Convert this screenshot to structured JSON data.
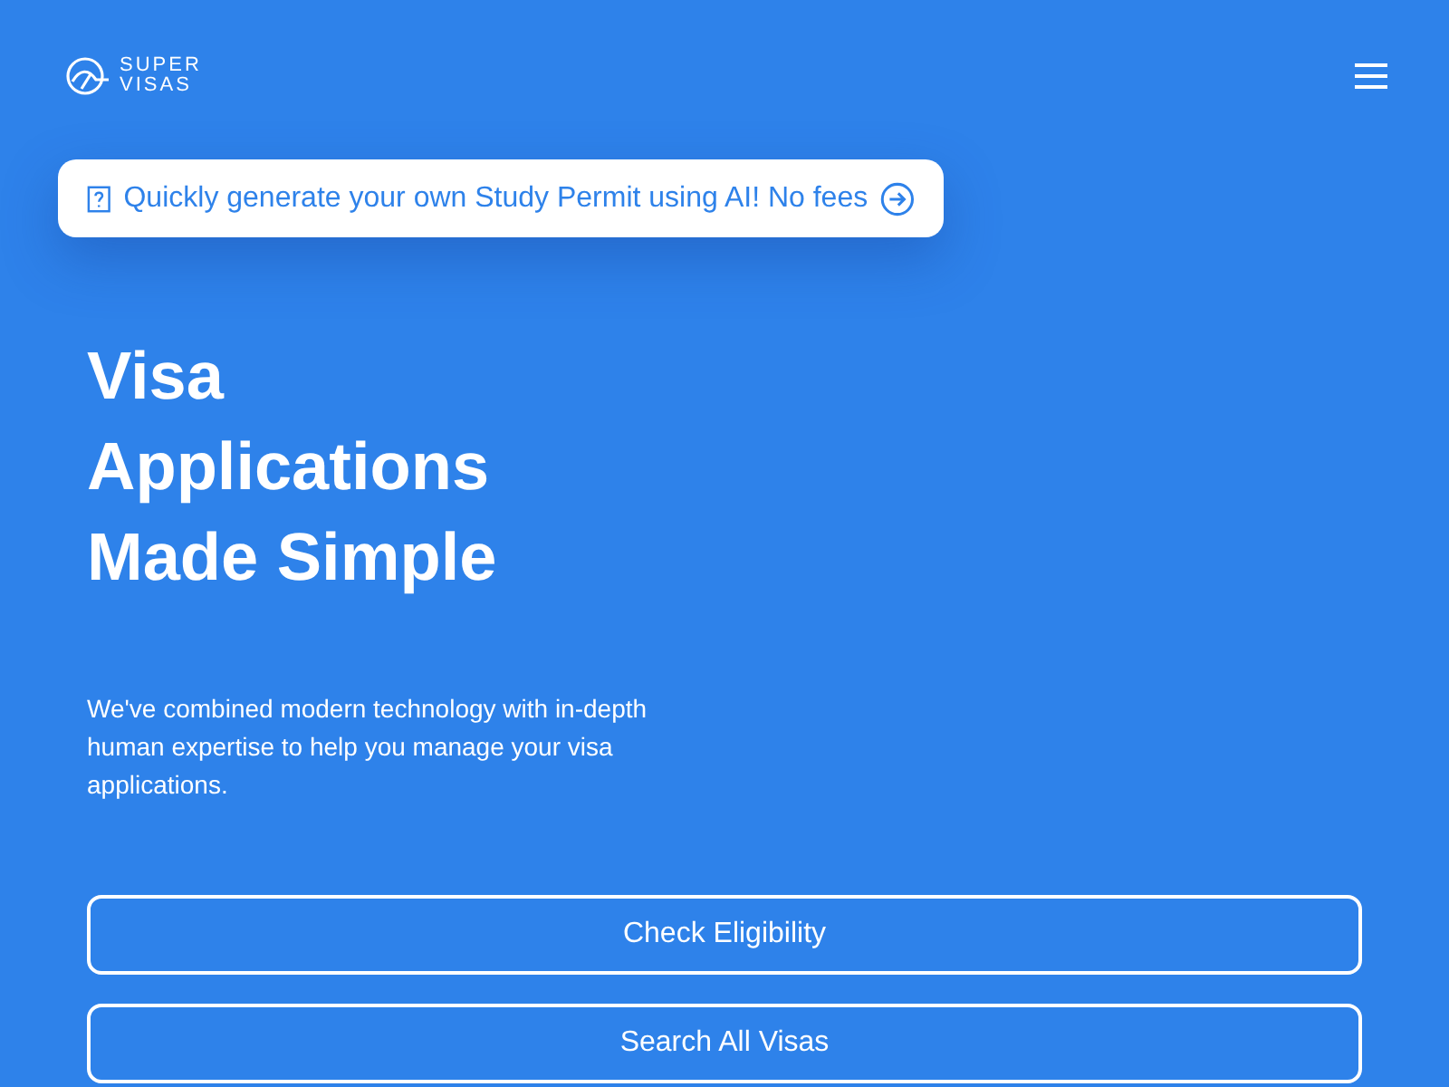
{
  "logo": {
    "line_1": "SUPER",
    "line_2": "VISAS"
  },
  "banner": {
    "text": "Quickly generate your own Study Permit using AI! No fees"
  },
  "hero": {
    "title_lines": [
      "Visa",
      "Applications",
      "Made Simple"
    ],
    "description": "We've combined modern technology with in-depth human expertise to help you manage your visa applications."
  },
  "buttons": [
    "Check Eligibility",
    "Search All Visas"
  ]
}
